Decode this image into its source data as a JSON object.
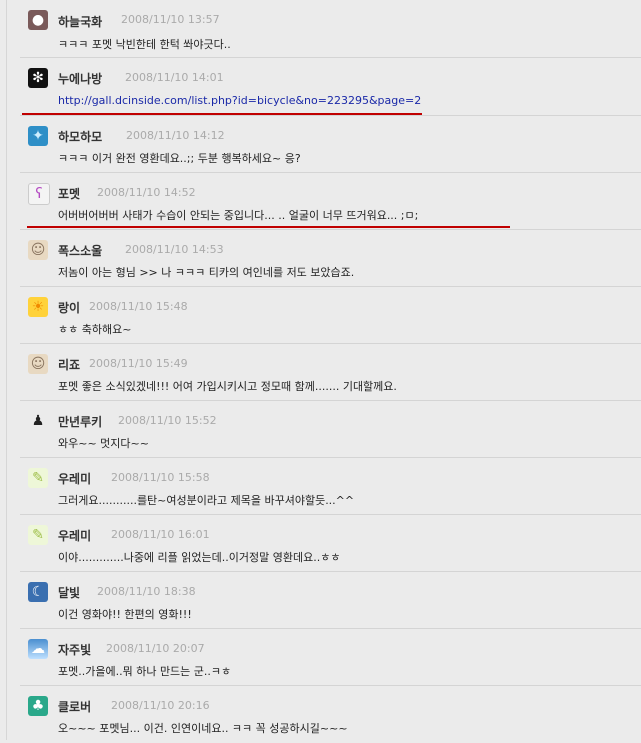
{
  "comments": [
    {
      "author": "하늘국화",
      "time": "2008/11/10 13:57",
      "text": "ㅋㅋㅋ 포멧 낙빈한테 한턱 쏴야긋다..",
      "avatar": "pig-icon",
      "avatar_color": "#7a5a5a"
    },
    {
      "author": "누에나방",
      "time": "2008/11/10 14:01",
      "text": "http://gall.dcinside.com/list.php?id=bicycle&no=223295&page=2",
      "avatar": "moth-icon",
      "avatar_color": "#111111",
      "is_link": true
    },
    {
      "author": "하모하모",
      "time": "2008/11/10 14:12",
      "text": "ㅋㅋㅋ 이거 완전 영환데요..;; 두분 행복하세요~ 응?",
      "avatar": "pattern-icon",
      "avatar_color": "#2e8fc7"
    },
    {
      "author": "포멧",
      "time": "2008/11/10 14:52",
      "text": "어버버어버버 사태가 수습이 안되는 중입니다... .. 얼굴이 너무 뜨거워요... ;ㅁ;",
      "avatar": "bear-icon",
      "avatar_color": "#b44ac2"
    },
    {
      "author": "폭스소울",
      "time": "2008/11/10 14:53",
      "text": "저놈이 아는 형님 >> 나 ㅋㅋㅋ 티카의 여인네를 저도 보았습죠.",
      "avatar": "old-man-icon",
      "avatar_color": "#8a7560"
    },
    {
      "author": "랑이",
      "time": "2008/11/10 15:48",
      "text": "ㅎㅎ 축하해요~",
      "avatar": "sun-icon",
      "avatar_color": "#f08a00"
    },
    {
      "author": "리죠",
      "time": "2008/11/10 15:49",
      "text": "포멧 좋은 소식있겠네!!! 어여 가입시키시고 정모때 함께....... 기대할께요.",
      "avatar": "old-man-icon",
      "avatar_color": "#8a7560"
    },
    {
      "author": "만년루키",
      "time": "2008/11/10 15:52",
      "text": "와우~~ 멋지다~~",
      "avatar": "character-icon",
      "avatar_color": "#222222"
    },
    {
      "author": "우레미",
      "time": "2008/11/10 15:58",
      "text": "그러게요...........를탄~여성분이라고 제목을 바꾸셔야할듯...^^",
      "avatar": "duck-icon",
      "avatar_color": "#9fbf4a"
    },
    {
      "author": "우레미",
      "time": "2008/11/10 16:01",
      "text": "이야.............나중에 리플 읽었는데..이거정말 영환데요..ㅎㅎ",
      "avatar": "duck-icon",
      "avatar_color": "#9fbf4a"
    },
    {
      "author": "달빛",
      "time": "2008/11/10 18:38",
      "text": "이건 영화야!! 한편의 영화!!!",
      "avatar": "moon-icon",
      "avatar_color": "#3a6fb0"
    },
    {
      "author": "자주빛",
      "time": "2008/11/10 20:07",
      "text": "포멧..가을에..뭐 하나 만드는 군..ㅋㅎ",
      "avatar": "landscape-icon",
      "avatar_color": "#4a8fd0"
    },
    {
      "author": "클로버",
      "time": "2008/11/10 20:16",
      "text": "오~~~ 포멧님... 이건. 인연이네요.. ㅋㅋ 꼭 성공하시길~~~",
      "avatar": "clover-icon",
      "avatar_color": "#2aa88a"
    }
  ],
  "highlight_color": "#c00000"
}
